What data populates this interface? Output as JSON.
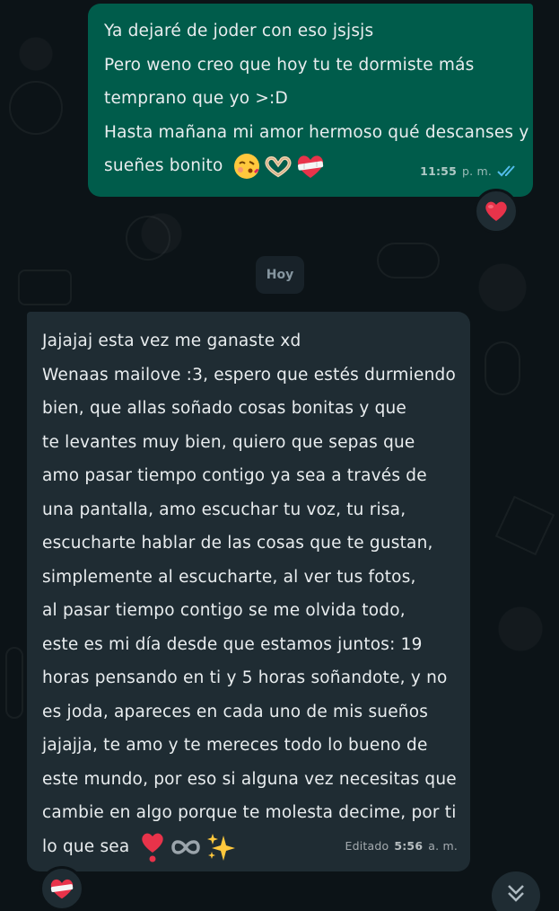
{
  "outgoing_message": {
    "lines": [
      "Ya dejaré de joder con eso jsjsjs",
      "Pero weno creo que hoy tu te dormiste más",
      "temprano que yo >:D",
      "Hasta mañana mi amor hermoso qué descanses y",
      "sueñes bonito"
    ],
    "emojis": [
      "kissing-face-emoji",
      "heart-hands-emoji",
      "mending-heart-emoji"
    ],
    "time": "11:55",
    "time_suffix": "p. m.",
    "status": "read",
    "reaction": "red-heart-emoji"
  },
  "date_divider": "Hoy",
  "incoming_message": {
    "lines": [
      "Jajajaj esta vez me ganaste xd",
      "Wenaas mailove :3, espero que estés durmiendo",
      "bien, que allas soñado cosas bonitas y que",
      "te levantes muy bien, quiero que sepas que",
      "amo pasar tiempo contigo ya sea a través de",
      "una pantalla, amo escuchar tu voz, tu risa,",
      "escucharte hablar de las cosas que te gustan,",
      "simplemente al escucharte, al ver tus fotos,",
      "al pasar tiempo contigo se me olvida todo,",
      "este es mi día desde que estamos juntos: 19",
      "horas pensando en ti y 5 horas soñandote, y no",
      "es joda, apareces en cada uno de mis sueños",
      "jajajja, te amo y te mereces todo lo bueno de",
      "este mundo, por eso si alguna vez necesitas que",
      "cambie en algo porque te molesta decime, por ti",
      "lo que sea"
    ],
    "emojis": [
      "heart-exclamation-emoji",
      "infinity-emoji",
      "sparkles-emoji"
    ],
    "edited_label": "Editado",
    "time": "5:56",
    "time_suffix": "a. m.",
    "reaction": "mending-heart-emoji"
  },
  "colors": {
    "outgoing_bubble": "#005c4b",
    "incoming_bubble": "#1f2c33",
    "background": "#0c1317",
    "read_ticks": "#53bdeb"
  },
  "scroll_button_icon": "double-chevron-down-icon"
}
